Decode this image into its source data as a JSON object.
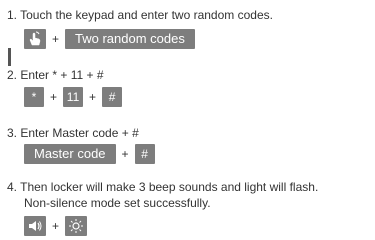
{
  "steps": [
    {
      "text": "1. Touch the keypad and enter two random codes.",
      "items": {
        "icon": "hand-touch-icon",
        "plus": "+",
        "button": "Two random codes"
      }
    },
    {
      "text": "2. Enter * + 11 + #",
      "items": {
        "k1": "*",
        "plus1": "+",
        "k2": "11",
        "plus2": "+",
        "k3": "#"
      }
    },
    {
      "text": "3. Enter Master code + #",
      "items": {
        "button": "Master code",
        "plus": "+",
        "k1": "#"
      }
    },
    {
      "text": "4. Then locker will make 3  beep sounds and light will flash.",
      "text2": "Non-silence mode set successfully.",
      "items": {
        "icon1": "speaker-icon",
        "plus": "+",
        "icon2": "light-bulb-icon"
      }
    }
  ],
  "colors": {
    "button_bg": "#7d7d7d",
    "button_text": "#ffffff",
    "text": "#333333"
  }
}
